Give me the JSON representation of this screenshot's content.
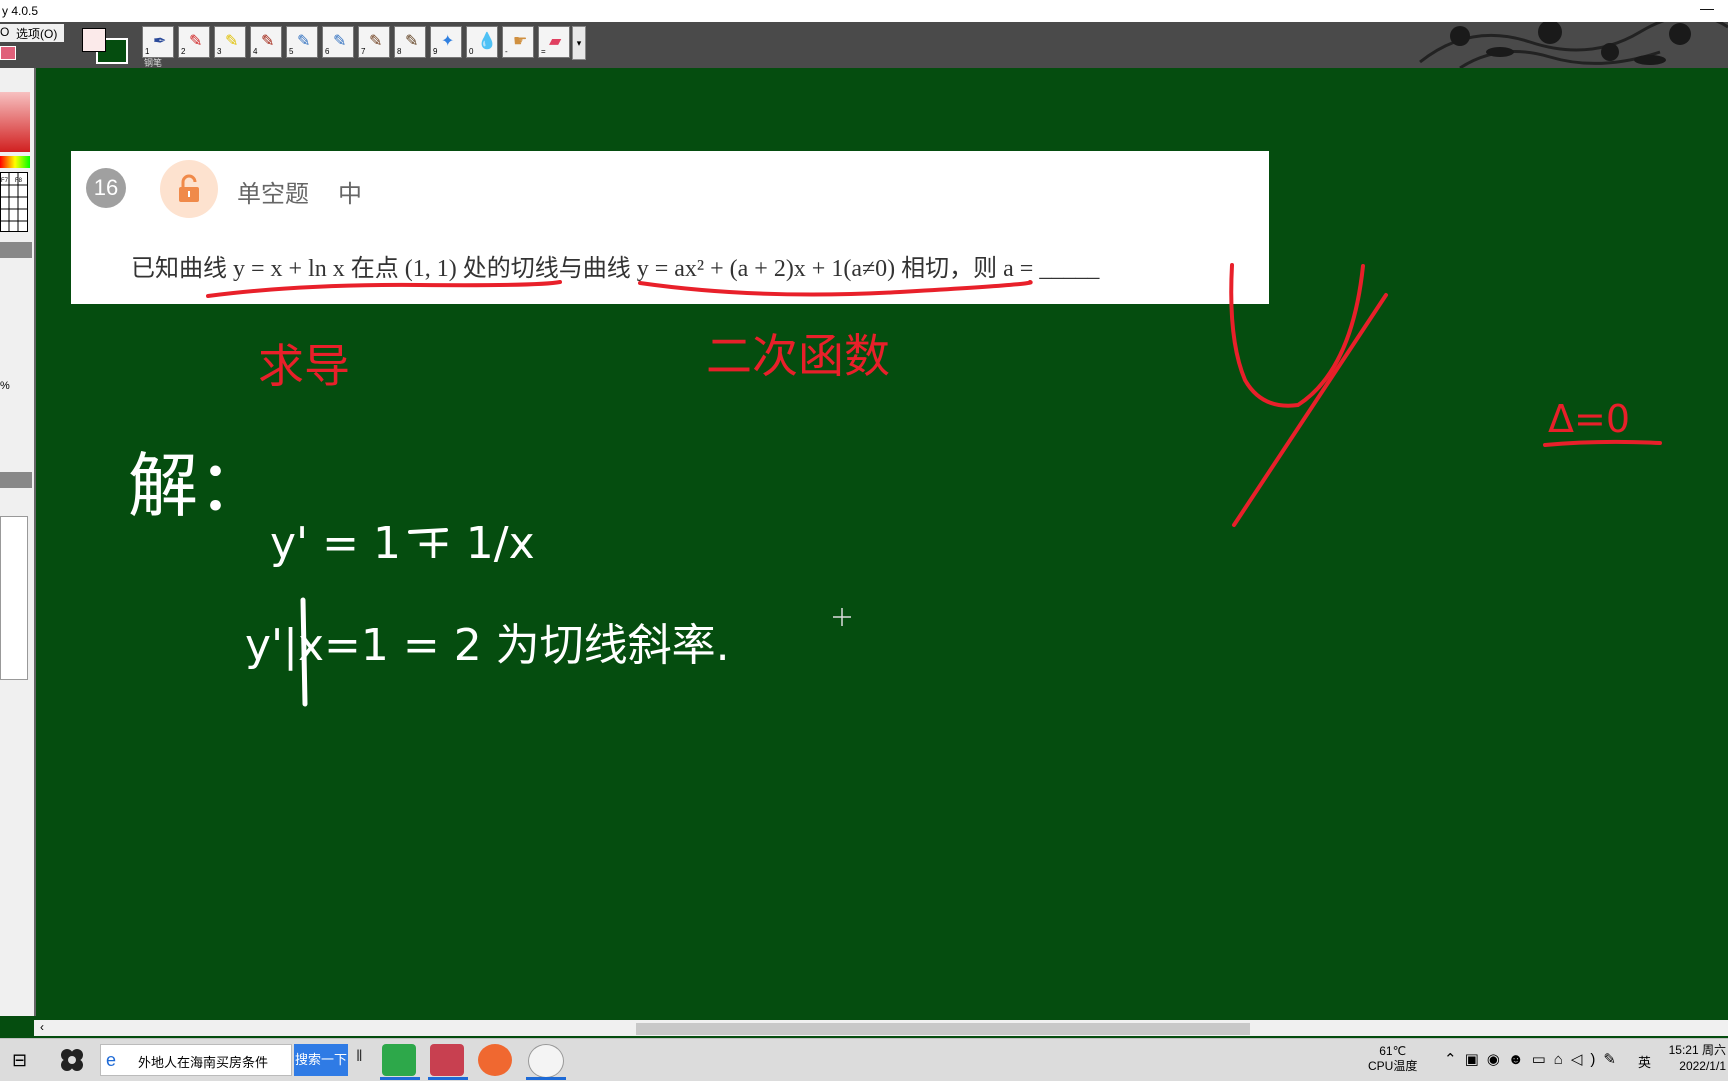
{
  "window": {
    "title": "y 4.0.5",
    "minimize_glyph": "—"
  },
  "menu": {
    "left_item": "O",
    "options_label": "选项(O)"
  },
  "toolbar": {
    "pen_label": "钢笔",
    "tools": [
      {
        "n": "1",
        "icon": "pen-icon"
      },
      {
        "n": "2",
        "icon": "red-pen-icon"
      },
      {
        "n": "3",
        "icon": "highlighter-icon"
      },
      {
        "n": "4",
        "icon": "marker-icon"
      },
      {
        "n": "5",
        "icon": "brush-icon"
      },
      {
        "n": "6",
        "icon": "brush-icon"
      },
      {
        "n": "7",
        "icon": "brush-icon"
      },
      {
        "n": "8",
        "icon": "brush-icon"
      },
      {
        "n": "9",
        "icon": "spray-icon"
      },
      {
        "n": "0",
        "icon": "drop-icon"
      },
      {
        "n": "-",
        "icon": "hand-icon"
      },
      {
        "n": "=",
        "icon": "eraser-icon"
      }
    ]
  },
  "left_panel": {
    "percent": "%",
    "grid_labels": [
      "F7",
      "F8"
    ]
  },
  "question": {
    "number": "16",
    "type": "单空题",
    "level": "中",
    "text": "已知曲线 y = x + ln x 在点 (1, 1) 处的切线与曲线 y = ax² + (a + 2)x + 1(a≠0) 相切，则 a = _____"
  },
  "handwriting": {
    "note1": "求导",
    "note2": "二次函数",
    "solution_label": "解：",
    "line1": "y' = 1 + 1/x",
    "line2": "y'|x=1 = 2 为切线斜率.",
    "delta": "Δ=0"
  },
  "taskbar": {
    "search_text": "外地人在海南买房条件",
    "search_button": "搜索一下",
    "temp": "61℃",
    "temp_label": "CPU温度",
    "lang": "英",
    "time": "15:21 周六",
    "date": "2022/1/1"
  },
  "colors": {
    "board": "#054d0f",
    "chalk": "#ffffff",
    "red_ink": "#e8202a",
    "accent": "#2f7be5"
  }
}
